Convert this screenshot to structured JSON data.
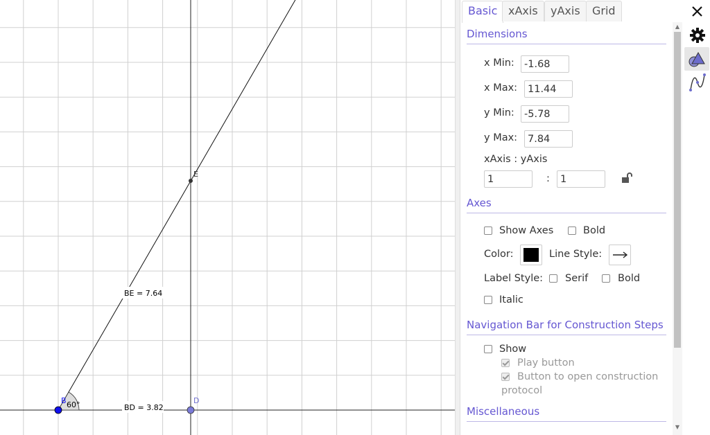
{
  "graphics": {
    "points": {
      "B": "B",
      "D": "D",
      "E": "E"
    },
    "segment_labels": {
      "BE": "BE = 7.64",
      "BD": "BD = 3.82"
    },
    "angle_label": "60°",
    "colors": {
      "point_B": "#0000ff",
      "point_D": "#6f6fcf",
      "point_E": "#333333",
      "angle_fill": "#dddddd"
    }
  },
  "properties": {
    "tabs": [
      "Basic",
      "xAxis",
      "yAxis",
      "Grid"
    ],
    "dimensions": {
      "title": "Dimensions",
      "x_min_label": "x Min:",
      "x_min_value": "-1.68",
      "x_max_label": "x Max:",
      "x_max_value": "11.44",
      "y_min_label": "y Min:",
      "y_min_value": "-5.78",
      "y_max_label": "y Max:",
      "y_max_value": "7.84",
      "ratio_label": "xAxis : yAxis",
      "ratio_x": "1",
      "ratio_sep": ":",
      "ratio_y": "1"
    },
    "axes": {
      "title": "Axes",
      "show_axes": "Show Axes",
      "bold": "Bold",
      "color_label": "Color:",
      "line_style_label": "Line Style:",
      "label_style_label": "Label Style:",
      "serif": "Serif",
      "bold2": "Bold",
      "italic": "Italic"
    },
    "navbar": {
      "title": "Navigation Bar for Construction Steps",
      "show": "Show",
      "play_button": "Play button",
      "open_protocol": "Button to open construction",
      "open_protocol_2": "protocol"
    },
    "misc": {
      "title": "Miscellaneous"
    },
    "accent_color": "#6557d2",
    "axis_color": "#000000"
  },
  "side_icons": [
    "close-icon",
    "gear-icon",
    "shapes-icon",
    "graph-curve-icon"
  ]
}
